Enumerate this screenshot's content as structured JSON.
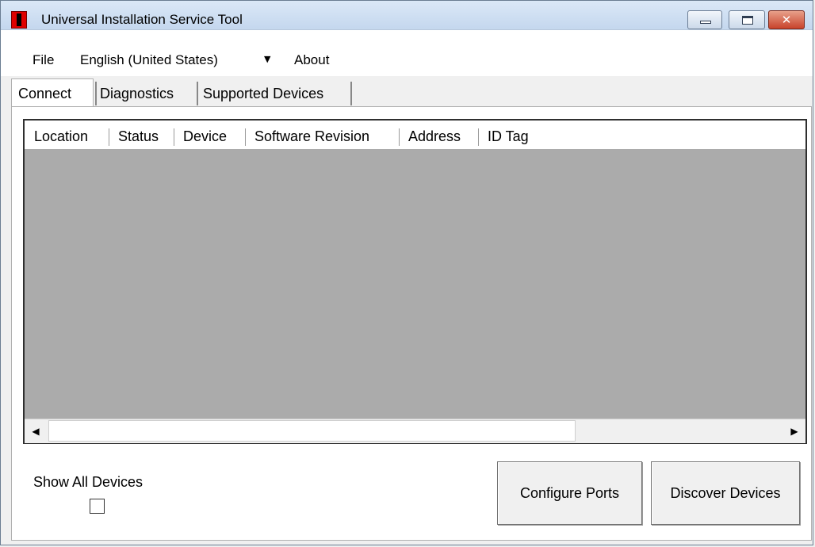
{
  "window": {
    "title": "Universal Installation Service Tool",
    "controls": {
      "minimize": "minimize",
      "maximize": "maximize",
      "close": "✕"
    }
  },
  "menu": {
    "file": "File",
    "language": "English (United States)",
    "language_arrow": "▼",
    "about": "About"
  },
  "tabs": [
    {
      "label": "Connect",
      "active": true
    },
    {
      "label": "Diagnostics",
      "active": false
    },
    {
      "label": "Supported Devices",
      "active": false
    }
  ],
  "device_list": {
    "columns": [
      "Location",
      "Status",
      "Device",
      "Software Revision",
      "Address",
      "ID Tag"
    ],
    "rows": []
  },
  "scrollbar": {
    "left_arrow": "◀",
    "right_arrow": "▶"
  },
  "footer": {
    "show_all_label": "Show All Devices",
    "show_all_checked": false,
    "configure_ports": "Configure Ports",
    "discover_devices": "Discover Devices"
  },
  "colors": {
    "app_icon": "#e00000",
    "list_background": "#ababab"
  }
}
